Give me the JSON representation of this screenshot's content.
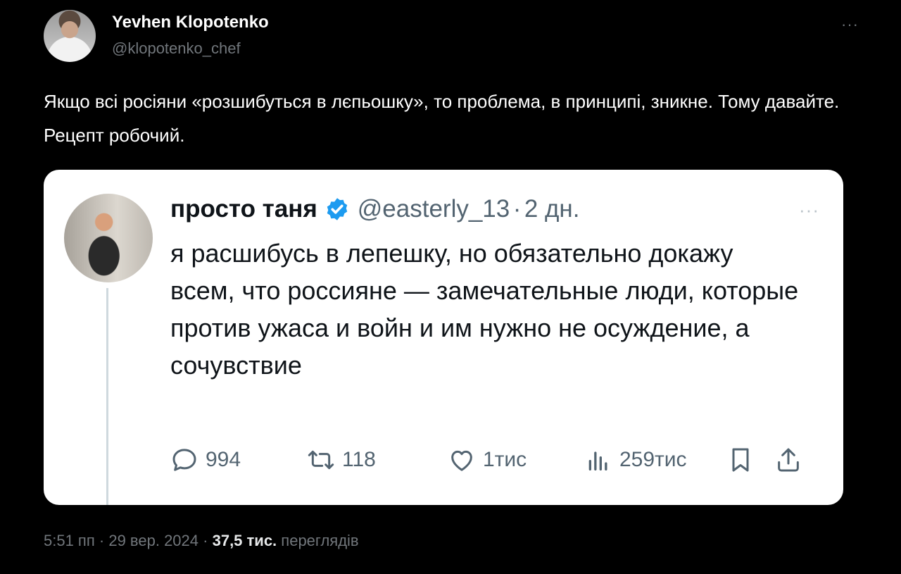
{
  "tweet": {
    "display_name": "Yevhen Klopotenko",
    "handle": "@klopotenko_chef",
    "text": "Якщо всі росіяни «розшибуться в лєпьошку», то проблема, в принципі, зникне. Тому давайте. Рецепт робочий.",
    "more_glyph": "···"
  },
  "quoted": {
    "display_name": "просто таня",
    "handle": "@easterly_13",
    "separator": "·",
    "time": "2 дн.",
    "text": "я расшибусь в лепешку, но обязательно докажу всем, что россияне — замечательные люди, которые против ужаса и войн и им нужно не осуждение, а сочувствие",
    "more_glyph": "···",
    "actions": {
      "replies": "994",
      "retweets": "118",
      "likes": "1тис",
      "views": "259тис"
    }
  },
  "meta": {
    "time": "5:51 пп",
    "sep1": "·",
    "date": "29 вер. 2024",
    "sep2": "·",
    "views_count": "37,5 тис.",
    "views_label": "переглядів"
  },
  "colors": {
    "background": "#000000",
    "text_primary": "#e7e9ea",
    "text_secondary": "#71767b",
    "card_bg": "#ffffff",
    "card_text": "#0f1419",
    "card_secondary": "#536471",
    "verified_blue": "#1d9bf0"
  },
  "icons": [
    "reply-icon",
    "retweet-icon",
    "like-icon",
    "views-icon",
    "bookmark-icon",
    "share-icon",
    "verified-badge-icon",
    "more-icon"
  ]
}
